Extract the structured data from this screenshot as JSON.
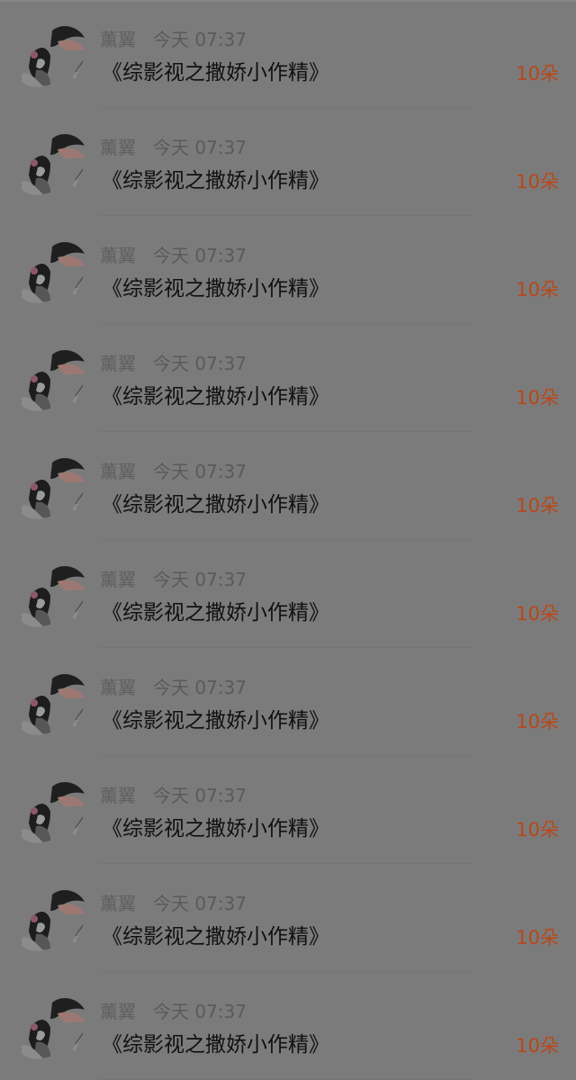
{
  "rewards": [
    {
      "user": "薰翼",
      "time": "今天 07:37",
      "book": "《综影视之撒娇小作精》",
      "amount": "10朵"
    },
    {
      "user": "薰翼",
      "time": "今天 07:37",
      "book": "《综影视之撒娇小作精》",
      "amount": "10朵"
    },
    {
      "user": "薰翼",
      "time": "今天 07:37",
      "book": "《综影视之撒娇小作精》",
      "amount": "10朵"
    },
    {
      "user": "薰翼",
      "time": "今天 07:37",
      "book": "《综影视之撒娇小作精》",
      "amount": "10朵"
    },
    {
      "user": "薰翼",
      "time": "今天 07:37",
      "book": "《综影视之撒娇小作精》",
      "amount": "10朵"
    },
    {
      "user": "薰翼",
      "time": "今天 07:37",
      "book": "《综影视之撒娇小作精》",
      "amount": "10朵"
    },
    {
      "user": "薰翼",
      "time": "今天 07:37",
      "book": "《综影视之撒娇小作精》",
      "amount": "10朵"
    },
    {
      "user": "薰翼",
      "time": "今天 07:37",
      "book": "《综影视之撒娇小作精》",
      "amount": "10朵"
    },
    {
      "user": "薰翼",
      "time": "今天 07:37",
      "book": "《综影视之撒娇小作精》",
      "amount": "10朵"
    },
    {
      "user": "薰翼",
      "time": "今天 07:37",
      "book": "《综影视之撒娇小作精》",
      "amount": "10朵"
    }
  ],
  "colors": {
    "overlay_background": "#7b7b7b",
    "amount_accent": "#b8471a"
  },
  "icons": {
    "avatar": "anime-girl-avatar-icon"
  }
}
